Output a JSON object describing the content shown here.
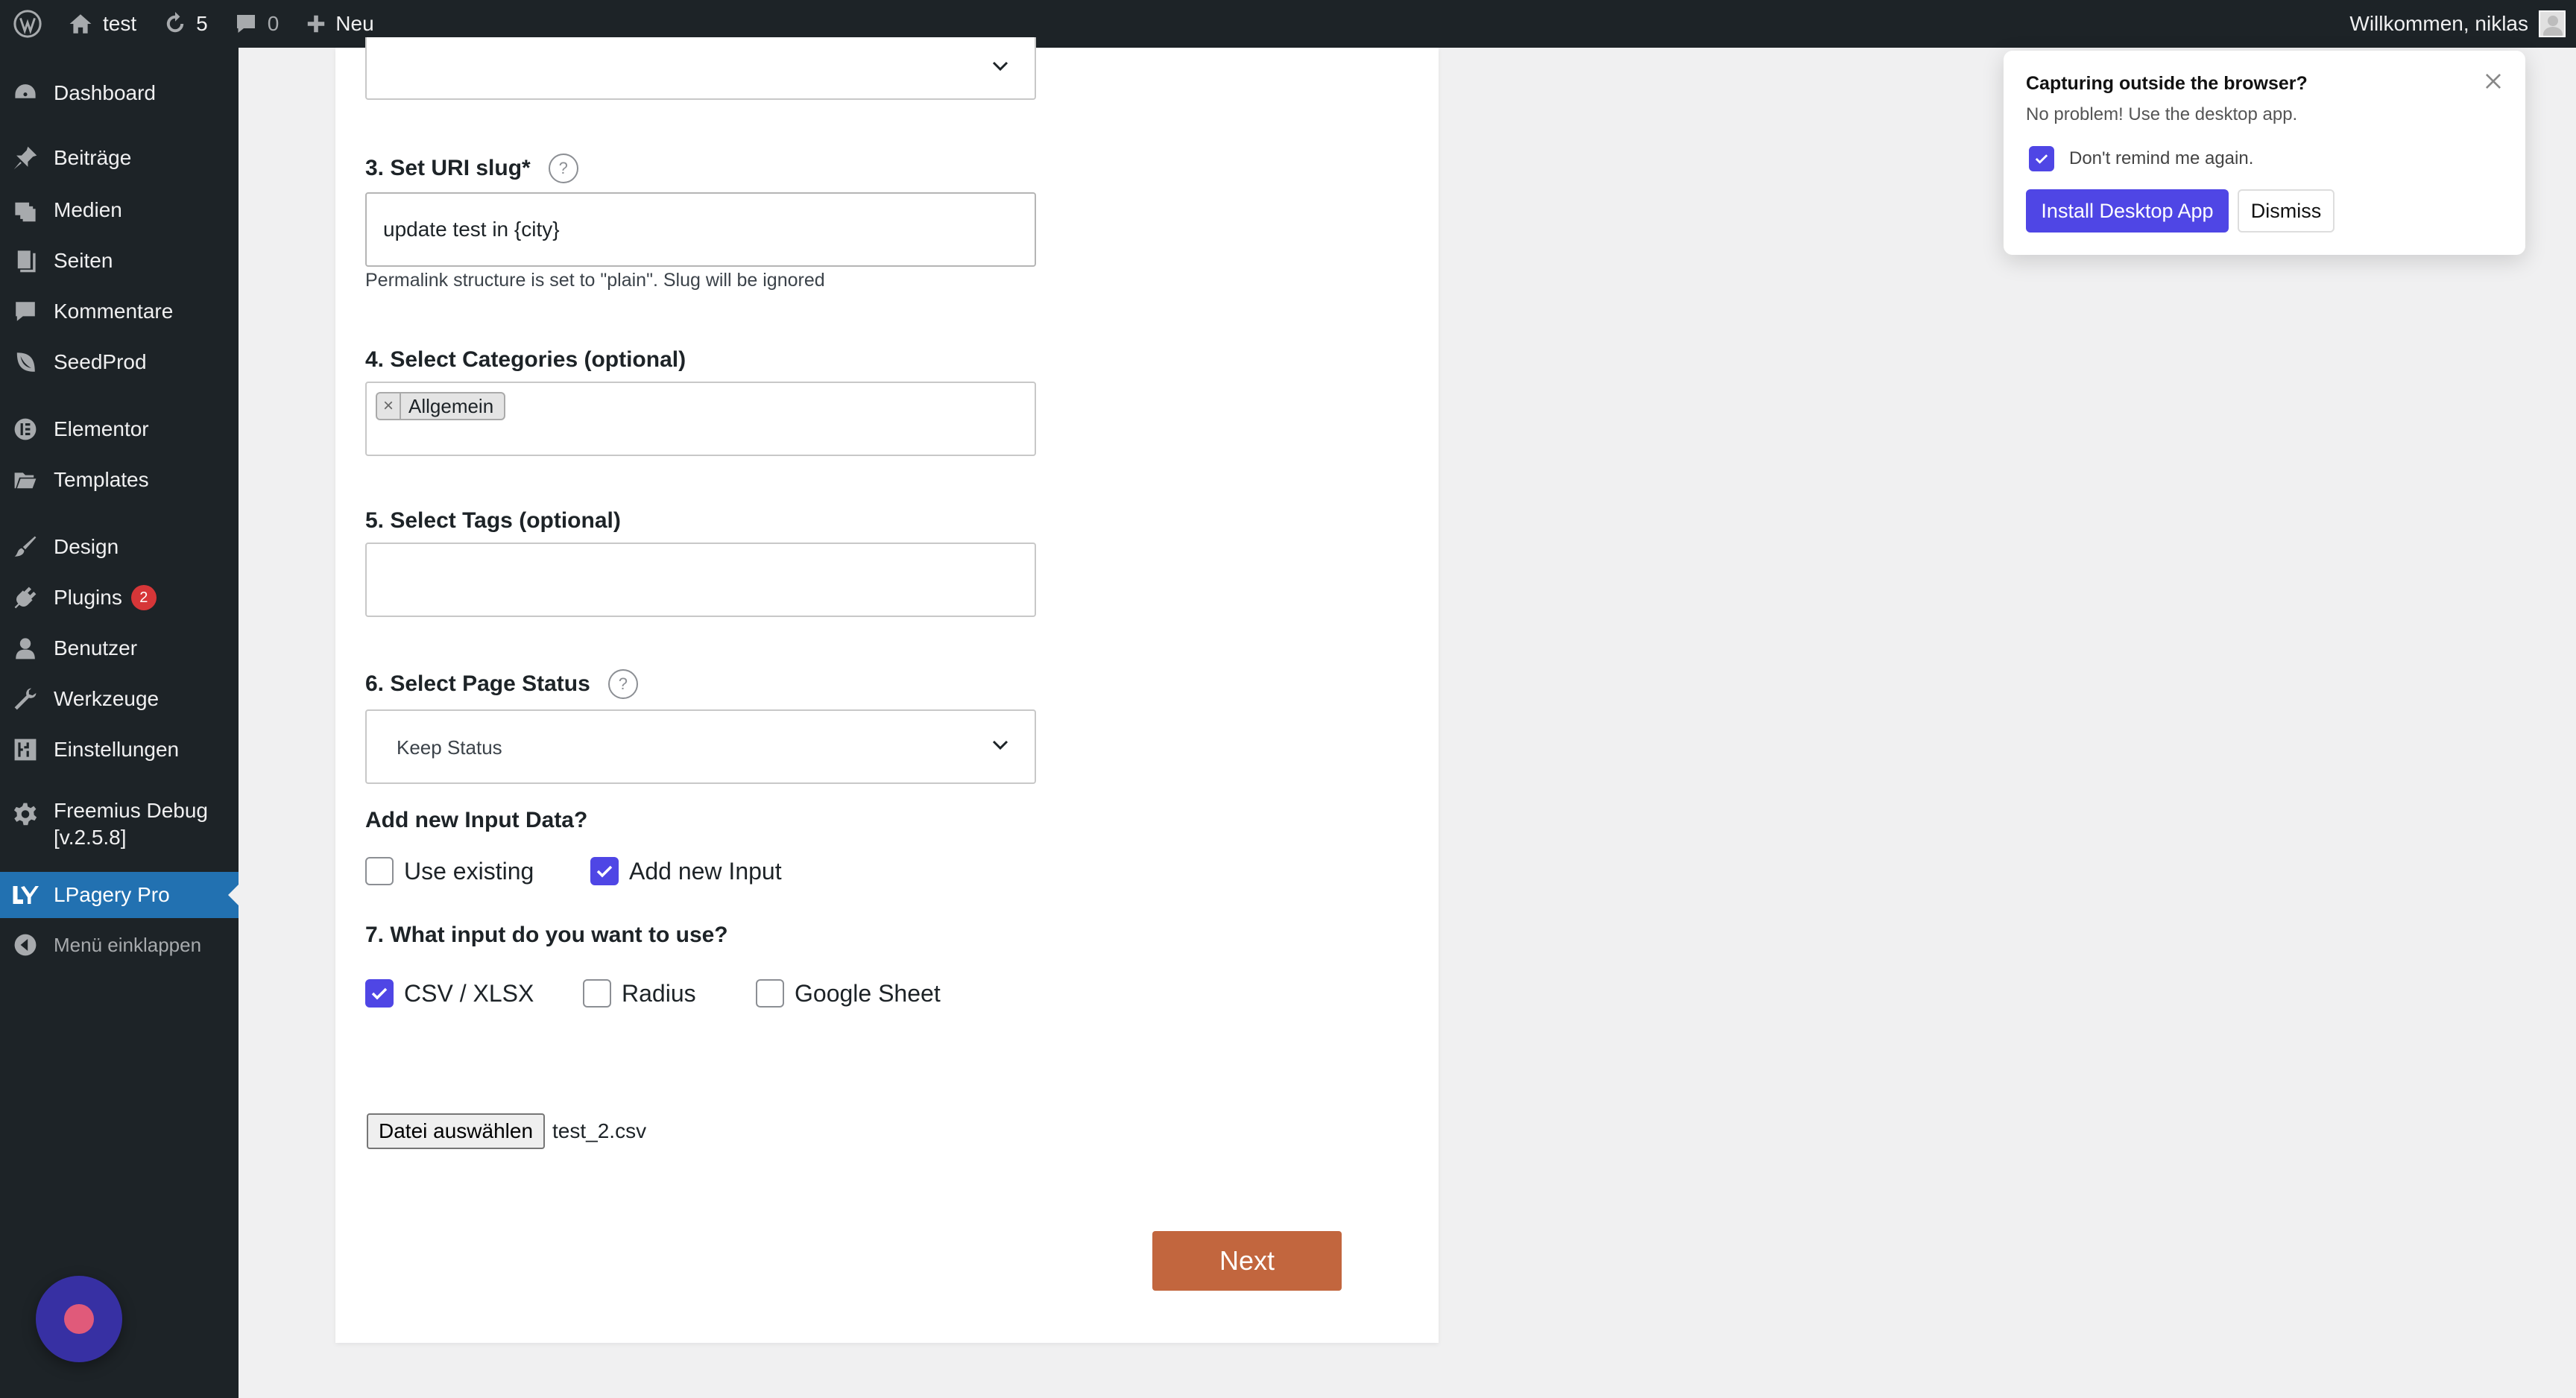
{
  "adminbar": {
    "site_name": "test",
    "updates_count": "5",
    "comments_count": "0",
    "new_label": "Neu",
    "welcome": "Willkommen, niklas"
  },
  "sidebar": {
    "items": [
      {
        "label": "Dashboard",
        "icon": "dashboard-icon"
      },
      {
        "label": "Beiträge",
        "icon": "pin-icon"
      },
      {
        "label": "Medien",
        "icon": "media-icon"
      },
      {
        "label": "Seiten",
        "icon": "pages-icon"
      },
      {
        "label": "Kommentare",
        "icon": "comment-icon"
      },
      {
        "label": "SeedProd",
        "icon": "seedprod-icon"
      },
      {
        "label": "Elementor",
        "icon": "elementor-icon"
      },
      {
        "label": "Templates",
        "icon": "folder-icon"
      },
      {
        "label": "Design",
        "icon": "brush-icon"
      },
      {
        "label": "Plugins",
        "icon": "plugin-icon",
        "badge": "2"
      },
      {
        "label": "Benutzer",
        "icon": "user-icon"
      },
      {
        "label": "Werkzeuge",
        "icon": "wrench-icon"
      },
      {
        "label": "Einstellungen",
        "icon": "settings-icon"
      },
      {
        "label_line1": "Freemius Debug",
        "label_line2": "[v.2.5.8]",
        "icon": "gear-icon"
      },
      {
        "label": "LPagery Pro",
        "icon": "lpagery-icon"
      },
      {
        "label": "Menü einklappen",
        "icon": "collapse-icon"
      }
    ]
  },
  "form": {
    "slug_label": "3. Set URI slug*",
    "slug_value": "update test in {city}",
    "permalink_hint": "Permalink structure is set to \"plain\". Slug will be ignored",
    "categories_label": "4. Select Categories (optional)",
    "category_chip": "Allgemein",
    "tags_label": "5. Select Tags (optional)",
    "status_label": "6. Select Page Status",
    "status_value": "Keep Status",
    "input_data_label": "Add new Input Data?",
    "use_existing": "Use existing",
    "add_new_input": "Add new Input",
    "input_type_label": "7. What input do you want to use?",
    "input_csv": "CSV / XLSX",
    "input_radius": "Radius",
    "input_sheet": "Google Sheet",
    "file_button": "Datei auswählen",
    "file_name": "test_2.csv",
    "next_button": "Next",
    "help_glyph": "?"
  },
  "popup": {
    "title": "Capturing outside the browser?",
    "subtitle": "No problem! Use the desktop app.",
    "remind": "Don't remind me again.",
    "install": "Install Desktop App",
    "dismiss": "Dismiss"
  },
  "colors": {
    "admin_dark": "#1d2327",
    "active_blue": "#2271b1",
    "accent_indigo": "#4f46e5",
    "next_orange": "#c2663e",
    "badge_red": "#d63638"
  }
}
